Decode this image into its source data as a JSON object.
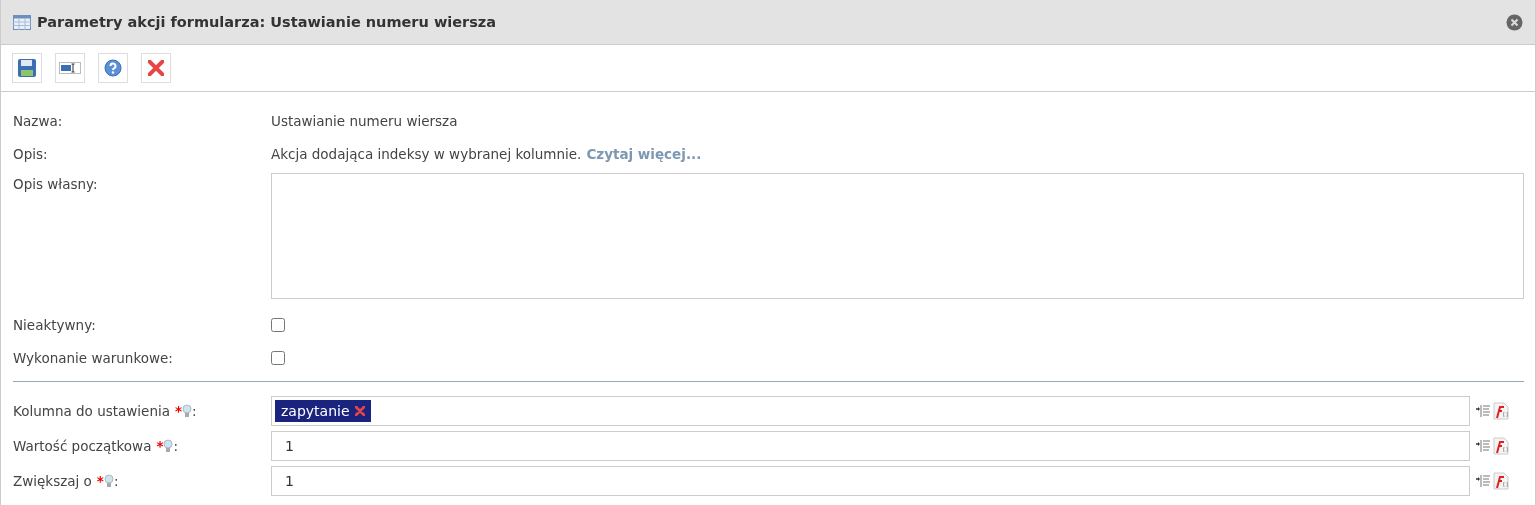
{
  "window": {
    "title": "Parametry akcji formularza: Ustawianie numeru wiersza"
  },
  "toolbar": [
    {
      "kind": "save"
    },
    {
      "kind": "field"
    },
    {
      "kind": "help"
    },
    {
      "kind": "cancel"
    }
  ],
  "info": [
    {
      "label": "Nazwa:",
      "value": "Ustawianie numeru wiersza"
    },
    {
      "label": "Opis:",
      "value": "Akcja dodająca indeksy w wybranej kolumnie.",
      "link": "Czytaj więcej..."
    }
  ],
  "own_description": {
    "label": "Opis własny:"
  },
  "checkboxes": [
    {
      "label": "Nieaktywny:",
      "checked": false
    },
    {
      "label": "Wykonanie warunkowe:",
      "checked": false
    }
  ],
  "params": [
    {
      "label": "Kolumna do ustawienia",
      "required_mark": "*",
      "colon": ":",
      "tags": [
        "zapytanie"
      ]
    },
    {
      "label": "Wartość początkowa",
      "required_mark": "*",
      "colon": ":",
      "value": "1"
    },
    {
      "label": "Zwiększaj o",
      "required_mark": "*",
      "colon": ":",
      "value": "1"
    }
  ]
}
